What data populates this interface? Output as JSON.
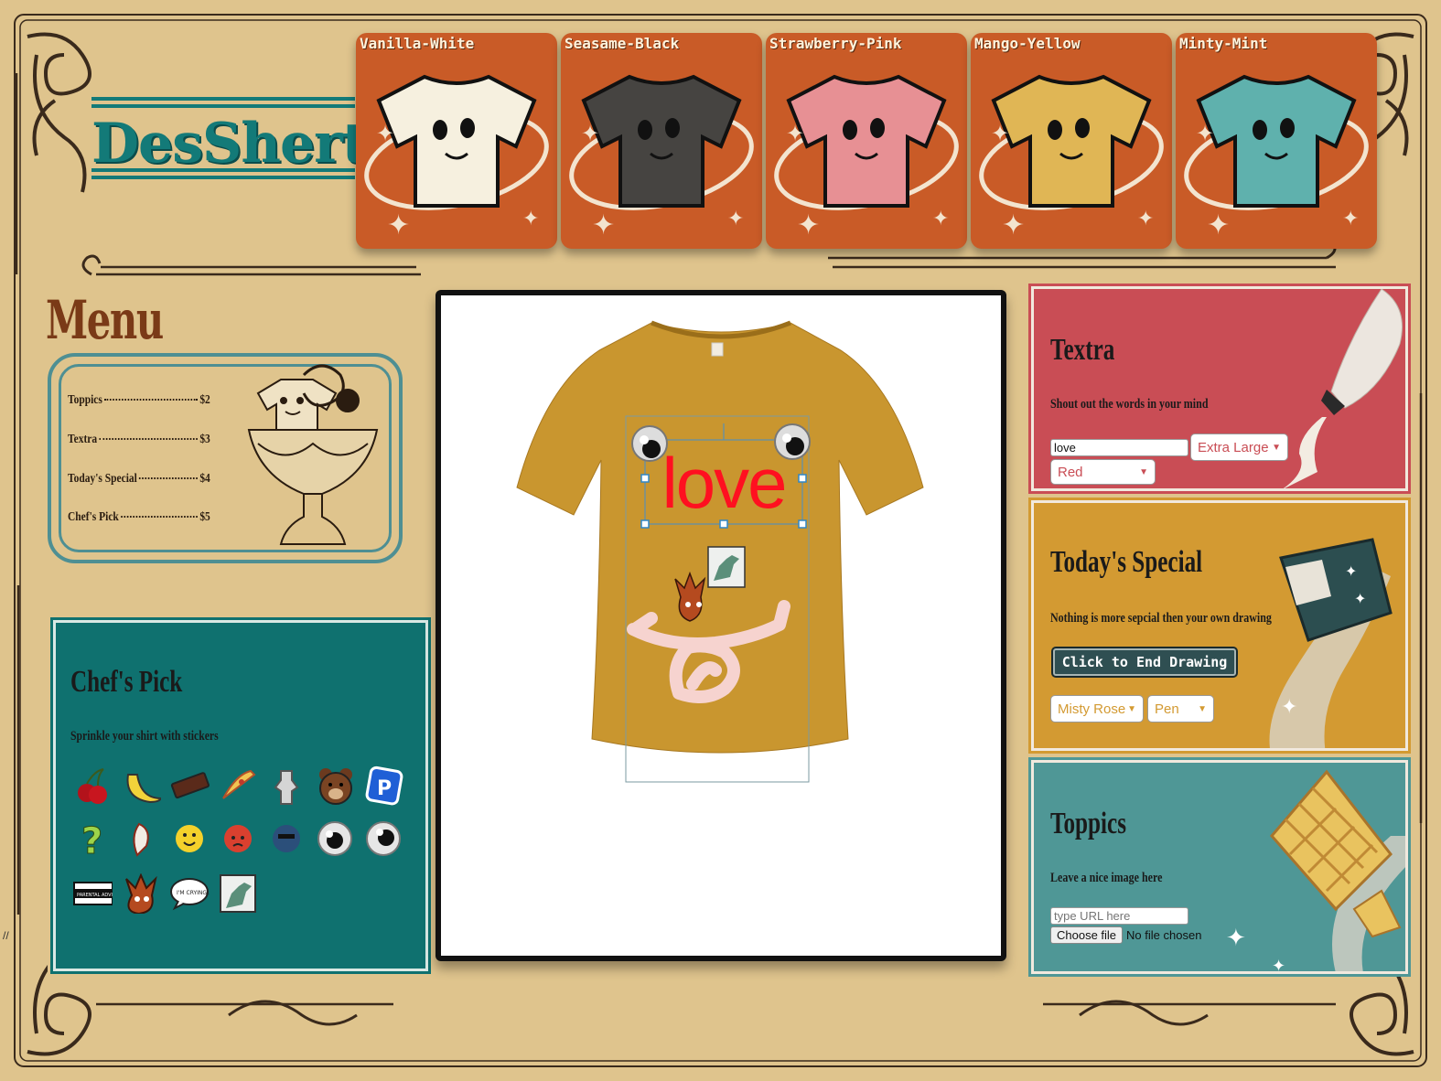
{
  "app": {
    "logo": "DesShert"
  },
  "colors": {
    "background": "#dfc48d",
    "brand_teal": "#137a78",
    "card_orange": "#c95b27",
    "menu_brown": "#7a3a17",
    "textra_bg": "#c94d55",
    "special_bg": "#d39a32",
    "toppics_bg": "#4f9796",
    "chef_bg": "#0f716f",
    "shirt": "#c9962f"
  },
  "shirt_cards": [
    {
      "label": "Vanilla-White",
      "color": "#f6f0df"
    },
    {
      "label": "Seasame-Black",
      "color": "#464441"
    },
    {
      "label": "Strawberry-Pink",
      "color": "#e79094"
    },
    {
      "label": "Mango-Yellow",
      "color": "#e0b655"
    },
    {
      "label": "Minty-Mint",
      "color": "#5fb1ad"
    }
  ],
  "menu": {
    "title": "Menu",
    "items": [
      {
        "name": "Toppics",
        "price": "$2"
      },
      {
        "name": "Textra",
        "price": "$3"
      },
      {
        "name": "Today's Special",
        "price": "$4"
      },
      {
        "name": "Chef's Pick",
        "price": "$5"
      }
    ]
  },
  "chefs_pick": {
    "title": "Chef's Pick",
    "subtitle": "Sprinkle your shirt with stickers",
    "stickers": [
      "cherry-icon",
      "banana-icon",
      "candy-bar-icon",
      "pizza-slice-icon",
      "statue-figure-icon",
      "bear-face-icon",
      "parking-sign-icon",
      "question-mark-icon",
      "feather-icon",
      "smiley-face-icon",
      "angry-face-icon",
      "cool-face-icon",
      "googly-eye-left-icon",
      "googly-eye-right-icon",
      "parental-advisory-icon",
      "flame-skull-icon",
      "crying-speech-bubble-icon",
      "statue-photo-icon"
    ],
    "crying_bubble_text": "I'M CRYING...",
    "advisory_text": "PARENTAL ADVISORY"
  },
  "design": {
    "text": "love",
    "text_color": "#ff1020",
    "drawing_color": "#f6d3cf"
  },
  "textra": {
    "title": "Textra",
    "subtitle": "Shout out the words in your mind",
    "input_value": "love",
    "size": "Extra Large",
    "color": "Red"
  },
  "special": {
    "title": "Today's Special",
    "subtitle": "Nothing is more sepcial then your own drawing",
    "button": "Click to End Drawing",
    "color": "Misty Rose",
    "tool": "Pen"
  },
  "toppics": {
    "title": "Toppics",
    "subtitle": "Leave a nice image here",
    "url_placeholder": "type URL here",
    "file_button": "Choose file",
    "file_status": "No file chosen"
  },
  "stray_text": "//"
}
